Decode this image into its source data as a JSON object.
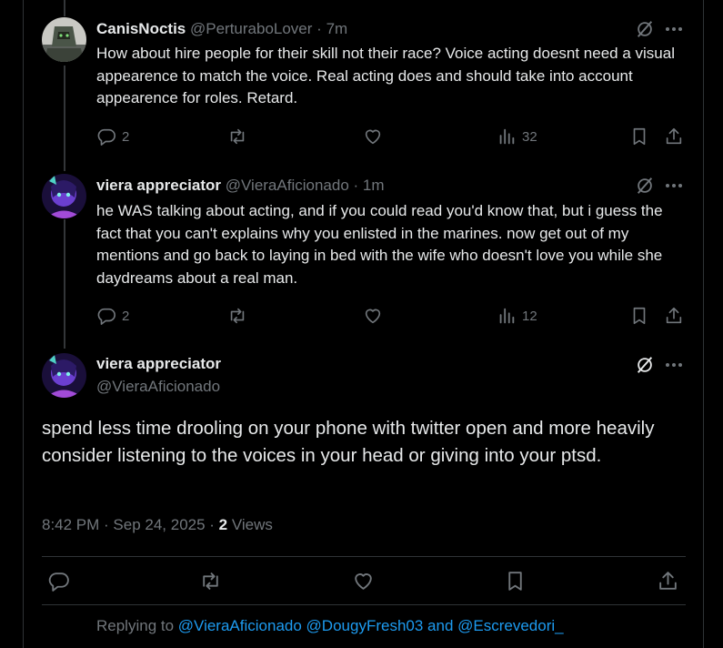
{
  "colors": {
    "background": "#000000",
    "text": "#e7e9ea",
    "muted": "#71767b",
    "accent": "#1d9bf0"
  },
  "replies": [
    {
      "name": "CanisNoctis",
      "handle": "@PerturaboLover",
      "dot": "·",
      "time": "7m",
      "text": "How about hire people for their skill not their race? Voice acting doesnt need a visual appearence to match the voice. Real acting does and should take into account appearence for roles. Retard.",
      "reply_count": "2",
      "views": "32"
    },
    {
      "name": "viera appreciator",
      "handle": "@VieraAficionado",
      "dot": "·",
      "time": "1m",
      "text": "he WAS talking about acting, and if you could read you'd know that, but i guess the fact that you can't explains why you enlisted in the marines. now get out of my mentions and go back to laying in bed with the wife who doesn't love you while she daydreams about a real man.",
      "reply_count": "2",
      "views": "12"
    }
  ],
  "main_post": {
    "name": "viera appreciator",
    "handle": "@VieraAficionado",
    "text": "spend less time drooling on your phone with twitter open and more heavily consider listening to the voices in your head or giving into your ptsd.",
    "timestamp": "8:42 PM · Sep 24, 2025 · ",
    "views_count": "2",
    "views_label": " Views"
  },
  "replying_to": {
    "prefix": "Replying to ",
    "mention1": "@VieraAficionado",
    "sep1": " ",
    "mention2": "@DougyFresh03",
    "sep2": " and ",
    "mention3": "@Escrevedori_"
  },
  "icons": [
    "grok-icon",
    "more-icon",
    "reply-icon",
    "retweet-icon",
    "like-icon",
    "views-icon",
    "bookmark-icon",
    "share-icon"
  ]
}
